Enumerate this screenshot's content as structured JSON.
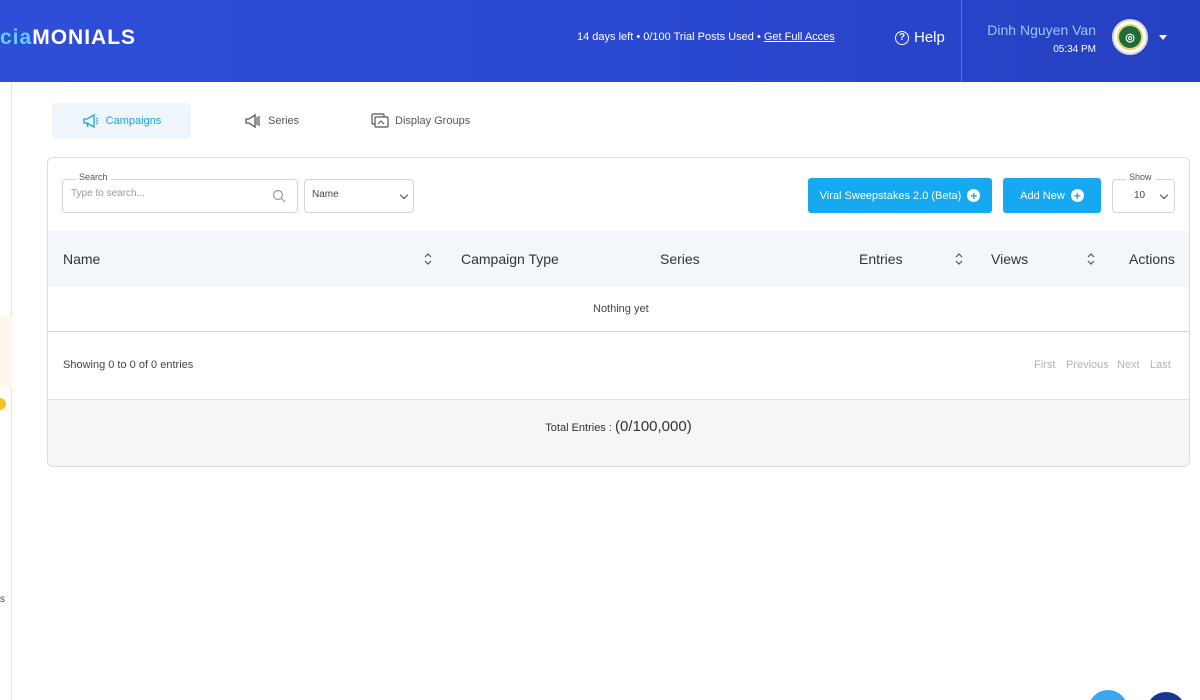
{
  "header": {
    "logo_prefix": "cia",
    "logo_suffix": "MONIALS",
    "trial_text": "14 days left • 0/100 Trial Posts Used • ",
    "trial_link": "Get Full Acces",
    "help_label": "Help",
    "user_name": "Dinh Nguyen Van",
    "user_time": "05:34 PM"
  },
  "sidebar": {
    "letter": "s"
  },
  "tabs": [
    {
      "label": "Campaigns",
      "icon": "megaphone-icon",
      "active": true
    },
    {
      "label": "Series",
      "icon": "series-icon",
      "active": false
    },
    {
      "label": "Display Groups",
      "icon": "display-groups-icon",
      "active": false
    }
  ],
  "toolbar": {
    "search_label": "Search",
    "search_placeholder": "Type to search...",
    "filter_value": "Name",
    "viral_button": "Viral Sweepstakes 2.0 (Beta)",
    "add_button": "Add New",
    "show_label": "Show",
    "show_value": "10"
  },
  "table": {
    "columns": [
      "Name",
      "Campaign Type",
      "Series",
      "Entries",
      "Views",
      "Actions"
    ],
    "empty_text": "Nothing yet",
    "showing": "Showing 0 to 0 of 0 entries",
    "pager": [
      "First",
      "Previous",
      "Next",
      "Last"
    ],
    "total_label": "Total Entries :",
    "total_value": "(0/100,000)"
  },
  "colors": {
    "header_bg": "#2f4ed8",
    "accent": "#16a9ef",
    "active_tab_bg": "#eef6fb"
  }
}
